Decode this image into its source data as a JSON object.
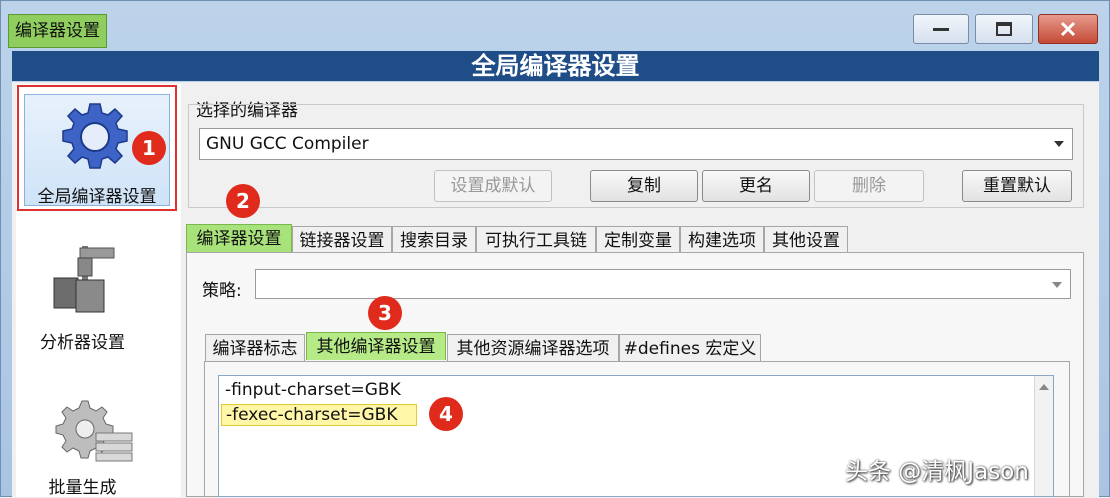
{
  "window": {
    "title": "编译器设置",
    "header": "全局编译器设置",
    "controls": [
      "minimize-icon",
      "maximize-icon",
      "close-icon"
    ]
  },
  "sidebar": {
    "items": [
      {
        "label": "全局编译器设置",
        "icon": "gear-icon",
        "selected": true
      },
      {
        "label": "分析器设置",
        "icon": "caliper-icon",
        "selected": false
      },
      {
        "label": "批量生成",
        "icon": "gear-stack-icon",
        "selected": false
      }
    ]
  },
  "compiler": {
    "section_label": "选择的编译器",
    "selected": "GNU GCC Compiler",
    "buttons": {
      "set_default": "设置成默认",
      "copy": "复制",
      "rename": "更名",
      "delete": "删除",
      "reset": "重置默认"
    }
  },
  "main_tabs": [
    "编译器设置",
    "链接器设置",
    "搜索目录",
    "可执行工具链",
    "定制变量",
    "构建选项",
    "其他设置"
  ],
  "policy": {
    "label": "策略:",
    "value": ""
  },
  "sub_tabs": [
    "编译器标志",
    "其他编译器设置",
    "其他资源编译器选项",
    "#defines 宏定义"
  ],
  "options_text": [
    "-finput-charset=GBK",
    "-fexec-charset=GBK"
  ],
  "annotations": [
    "1",
    "2",
    "3",
    "4"
  ],
  "watermark": "头条 @清枫Jason",
  "colors": {
    "header": "#1f4d88",
    "highlight_green": "#a8e27a",
    "marker_red": "#e02a1c",
    "highlight_yellow": "#fff6a8"
  }
}
